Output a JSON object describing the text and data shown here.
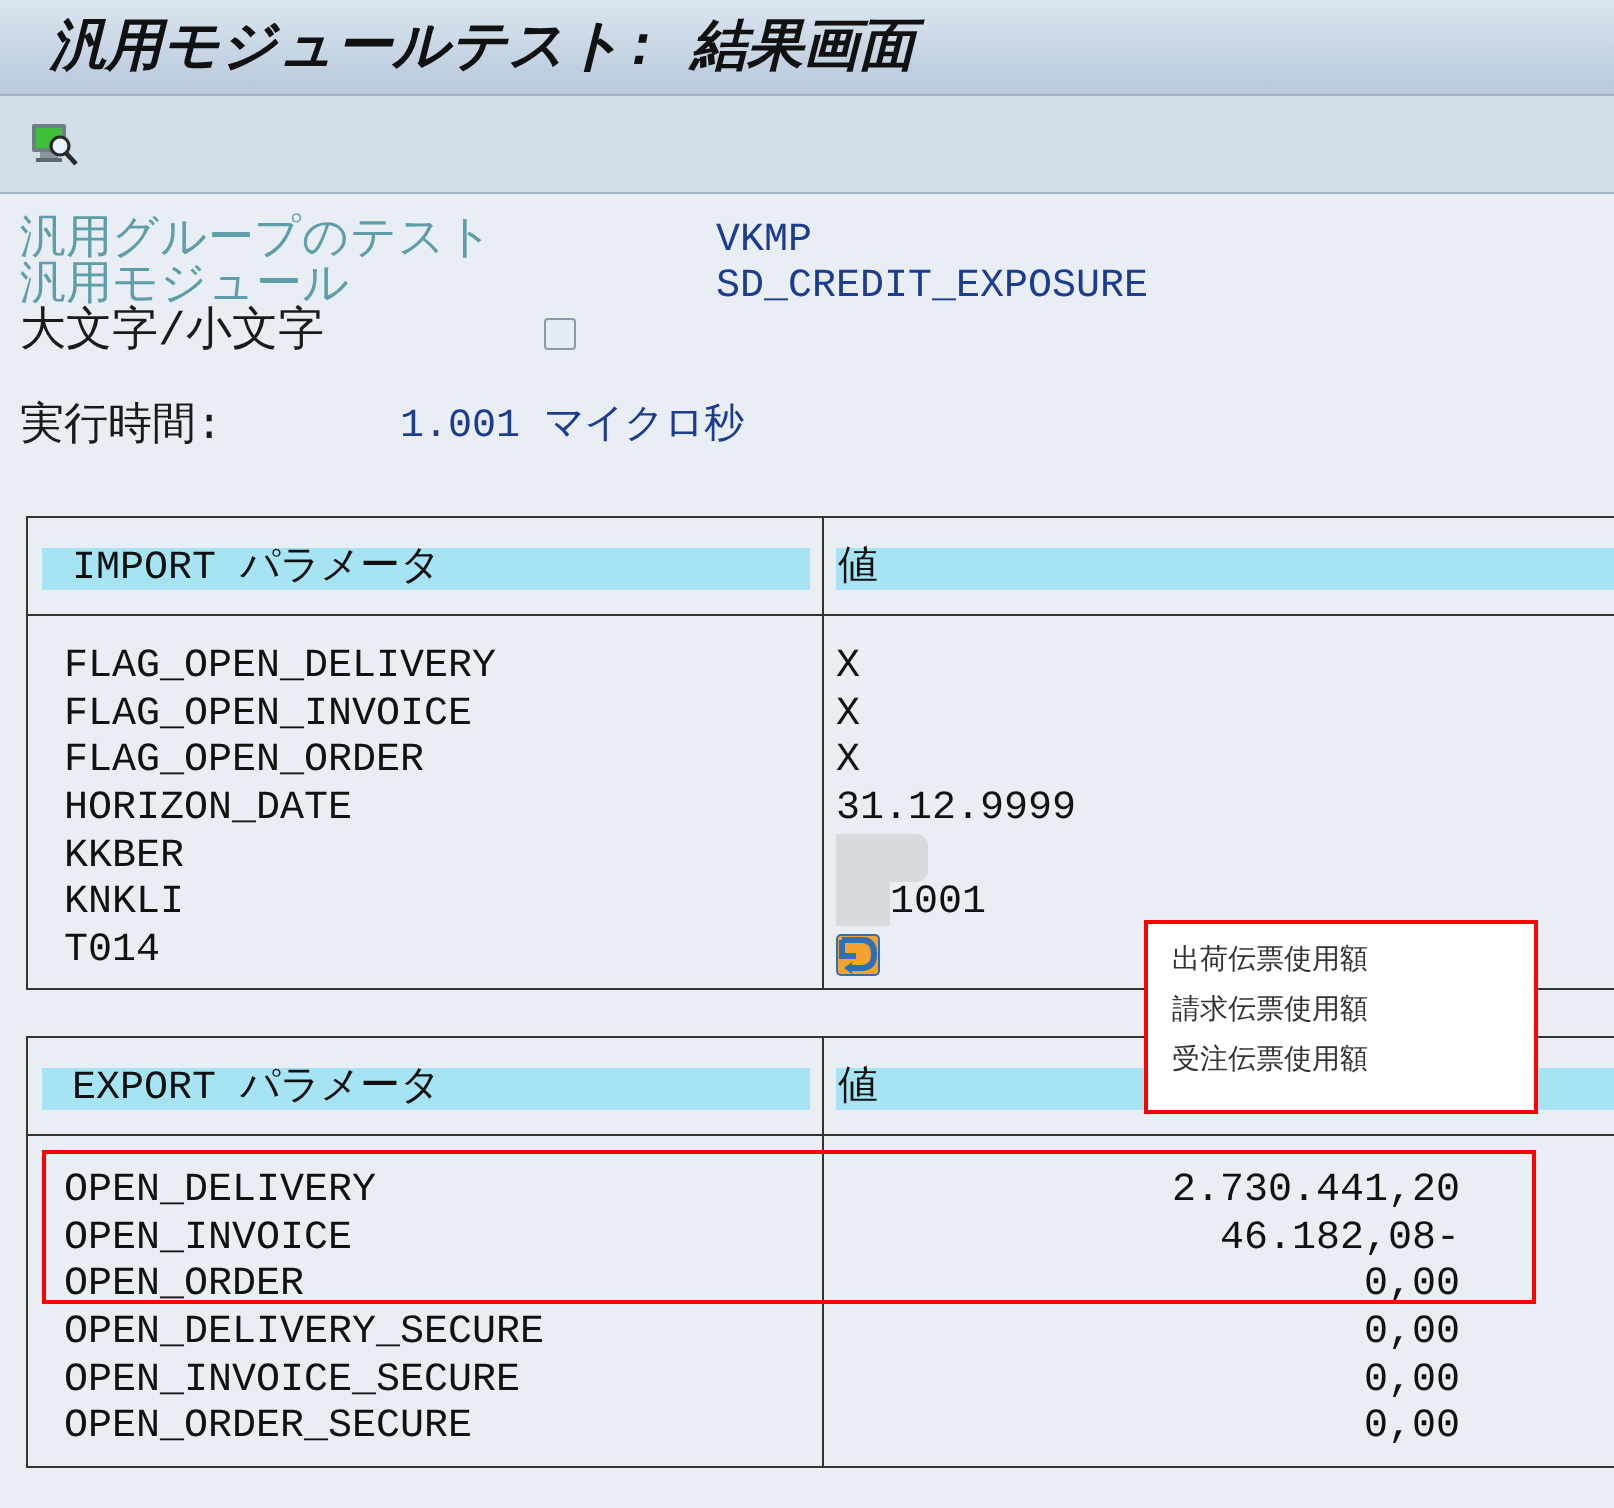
{
  "window": {
    "title": "汎用モジュールテスト: 結果画面"
  },
  "header_fields": [
    {
      "kind": "text",
      "label": "汎用グループのテスト",
      "value": "VKMP"
    },
    {
      "kind": "text",
      "label": "汎用モジュール",
      "value": "SD_CREDIT_EXPOSURE"
    },
    {
      "kind": "checkbox",
      "label": "大文字/小文字",
      "checked": false
    }
  ],
  "runtime": {
    "label": "実行時間:",
    "value": "1.001 マイクロ秒"
  },
  "import_table": {
    "columns": [
      "IMPORT パラメータ",
      "値"
    ],
    "rows": [
      {
        "kind": "text",
        "name": "FLAG_OPEN_DELIVERY",
        "value": "X"
      },
      {
        "kind": "text",
        "name": "FLAG_OPEN_INVOICE",
        "value": "X"
      },
      {
        "kind": "text",
        "name": "FLAG_OPEN_ORDER",
        "value": "X"
      },
      {
        "kind": "text",
        "name": "HORIZON_DATE",
        "value": "31.12.9999"
      },
      {
        "kind": "redacted",
        "name": "KKBER"
      },
      {
        "kind": "partly_redacted",
        "name": "KNKLI",
        "value": "1001"
      },
      {
        "kind": "icon",
        "name": "T014"
      }
    ]
  },
  "callout": {
    "lines": [
      "出荷伝票使用額",
      "請求伝票使用額",
      "受注伝票使用額"
    ]
  },
  "export_table": {
    "columns": [
      "EXPORT パラメータ",
      "値"
    ],
    "highlighted_rows": [
      {
        "name": "OPEN_DELIVERY",
        "value": "2.730.441,20"
      },
      {
        "name": "OPEN_INVOICE",
        "value": "46.182,08-"
      },
      {
        "name": "OPEN_ORDER",
        "value": "0,00"
      }
    ],
    "rows": [
      {
        "name": "OPEN_DELIVERY_SECURE",
        "value": "0,00"
      },
      {
        "name": "OPEN_INVOICE_SECURE",
        "value": "0,00"
      },
      {
        "name": "OPEN_ORDER_SECURE",
        "value": "0,00"
      }
    ]
  }
}
